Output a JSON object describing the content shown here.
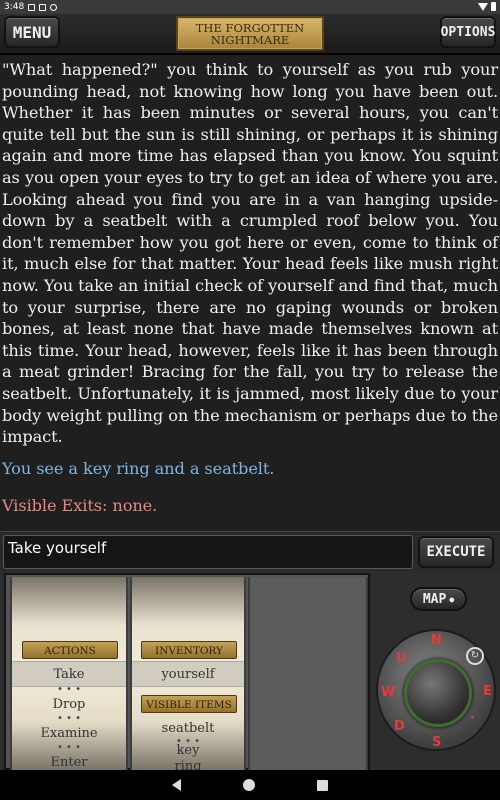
{
  "status_bar": {
    "time": "3:48"
  },
  "header": {
    "menu_label": "MENU",
    "title": "The Forgotten Nightmare",
    "options_label": "OPTIONS"
  },
  "story": {
    "text": "\"What happened?\" you think to yourself as you rub your pounding head, not knowing how long you have been out. Whether it has been minutes or several hours, you can't quite tell but the sun is still shining, or perhaps it is shining again and more time has elapsed than you know. You squint as you open your eyes to try to get an idea of where you are. Looking ahead you find you are in a van hanging upside-down by a seatbelt with a crumpled roof below you. You don't remember how you got here or even, come to think of it, much else for that matter. Your head feels like mush right now. You take an initial check of yourself and find that, much to your surprise, there are no gaping wounds or broken bones, at least none that have made themselves known at this time. Your head, however, feels like it has been through a meat grinder! Bracing for the fall, you try to release the seatbelt. Unfortunately, it is jammed, most likely due to your body weight pulling on the mechanism or perhaps due to the impact.",
    "you_see": "You see  a key ring and a seatbelt.",
    "exits": "Visible Exits: none."
  },
  "command": {
    "value": "Take yourself",
    "execute_label": "EXECUTE"
  },
  "actions": {
    "header": "Actions",
    "items": [
      "Take",
      "Drop",
      "Examine",
      "Enter"
    ],
    "selected": "Take"
  },
  "inventory": {
    "header": "Inventory",
    "items": [
      "yourself"
    ],
    "visible_header": "Visible Items",
    "visible_items": [
      "seatbelt",
      "key",
      "ring"
    ]
  },
  "map_label": "MAP",
  "compass": {
    "n": "N",
    "e": "E",
    "s": "S",
    "w": "W",
    "u": "U",
    "d": "D",
    "ne": "·",
    "se": "·"
  },
  "colors": {
    "story_bg": "#1f1f1f",
    "see_text": "#7fb4dd",
    "exits_text": "#e08a84",
    "compass_dirs": "#e63b3b",
    "plate_gold": "#c5a258"
  }
}
